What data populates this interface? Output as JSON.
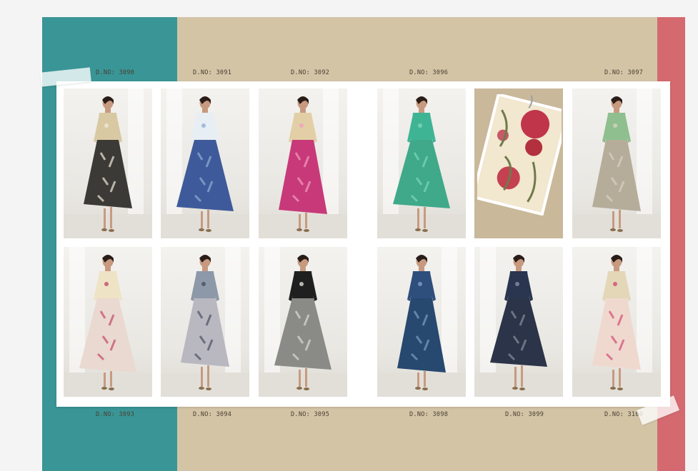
{
  "catalogue": {
    "design_numbers_top": [
      "D.NO: 3090",
      "D.NO: 3091",
      "D.NO: 3092",
      "D.NO: 3096",
      "D.NO: 3097"
    ],
    "design_numbers_bottom": [
      "D.NO: 3093",
      "D.NO: 3094",
      "D.NO: 3095",
      "D.NO: 3098",
      "D.NO: 3099",
      "D.NO: 3100"
    ]
  },
  "colors": {
    "teal_band": "#3a9596",
    "beige_band": "#d3c4a6",
    "pink_band": "#d46a6f",
    "sheet": "#ffffff"
  },
  "garments_top": [
    {
      "yoke": "#d8c9a3",
      "skirt": "#3b3a36",
      "accent": "#efe8d8"
    },
    {
      "yoke": "#e7eef4",
      "skirt": "#3f5a9a",
      "accent": "#8fb0d6"
    },
    {
      "yoke": "#e2cfa6",
      "skirt": "#c8397a",
      "accent": "#f2a0c0"
    },
    {
      "yoke": "#3fb495",
      "skirt": "#3fa98a",
      "accent": "#7ed8b8"
    },
    {
      "yoke": "#8fbf8f",
      "skirt": "#b5ad9a",
      "accent": "#d9d2c2"
    }
  ],
  "garments_bottom": [
    {
      "yoke": "#efe3c6",
      "skirt": "#e9d9d0",
      "accent": "#c4496a"
    },
    {
      "yoke": "#8d98a8",
      "skirt": "#b9b7c0",
      "accent": "#4a5062"
    },
    {
      "yoke": "#1f1f1f",
      "skirt": "#8a8a86",
      "accent": "#dcdcd6"
    },
    {
      "yoke": "#2e4f7c",
      "skirt": "#27486f",
      "accent": "#7f9fc4"
    },
    {
      "yoke": "#2a3550",
      "skirt": "#2b3448",
      "accent": "#8a8fa0"
    },
    {
      "yoke": "#e3d7b8",
      "skirt": "#efd9cf",
      "accent": "#d44a74"
    }
  ]
}
